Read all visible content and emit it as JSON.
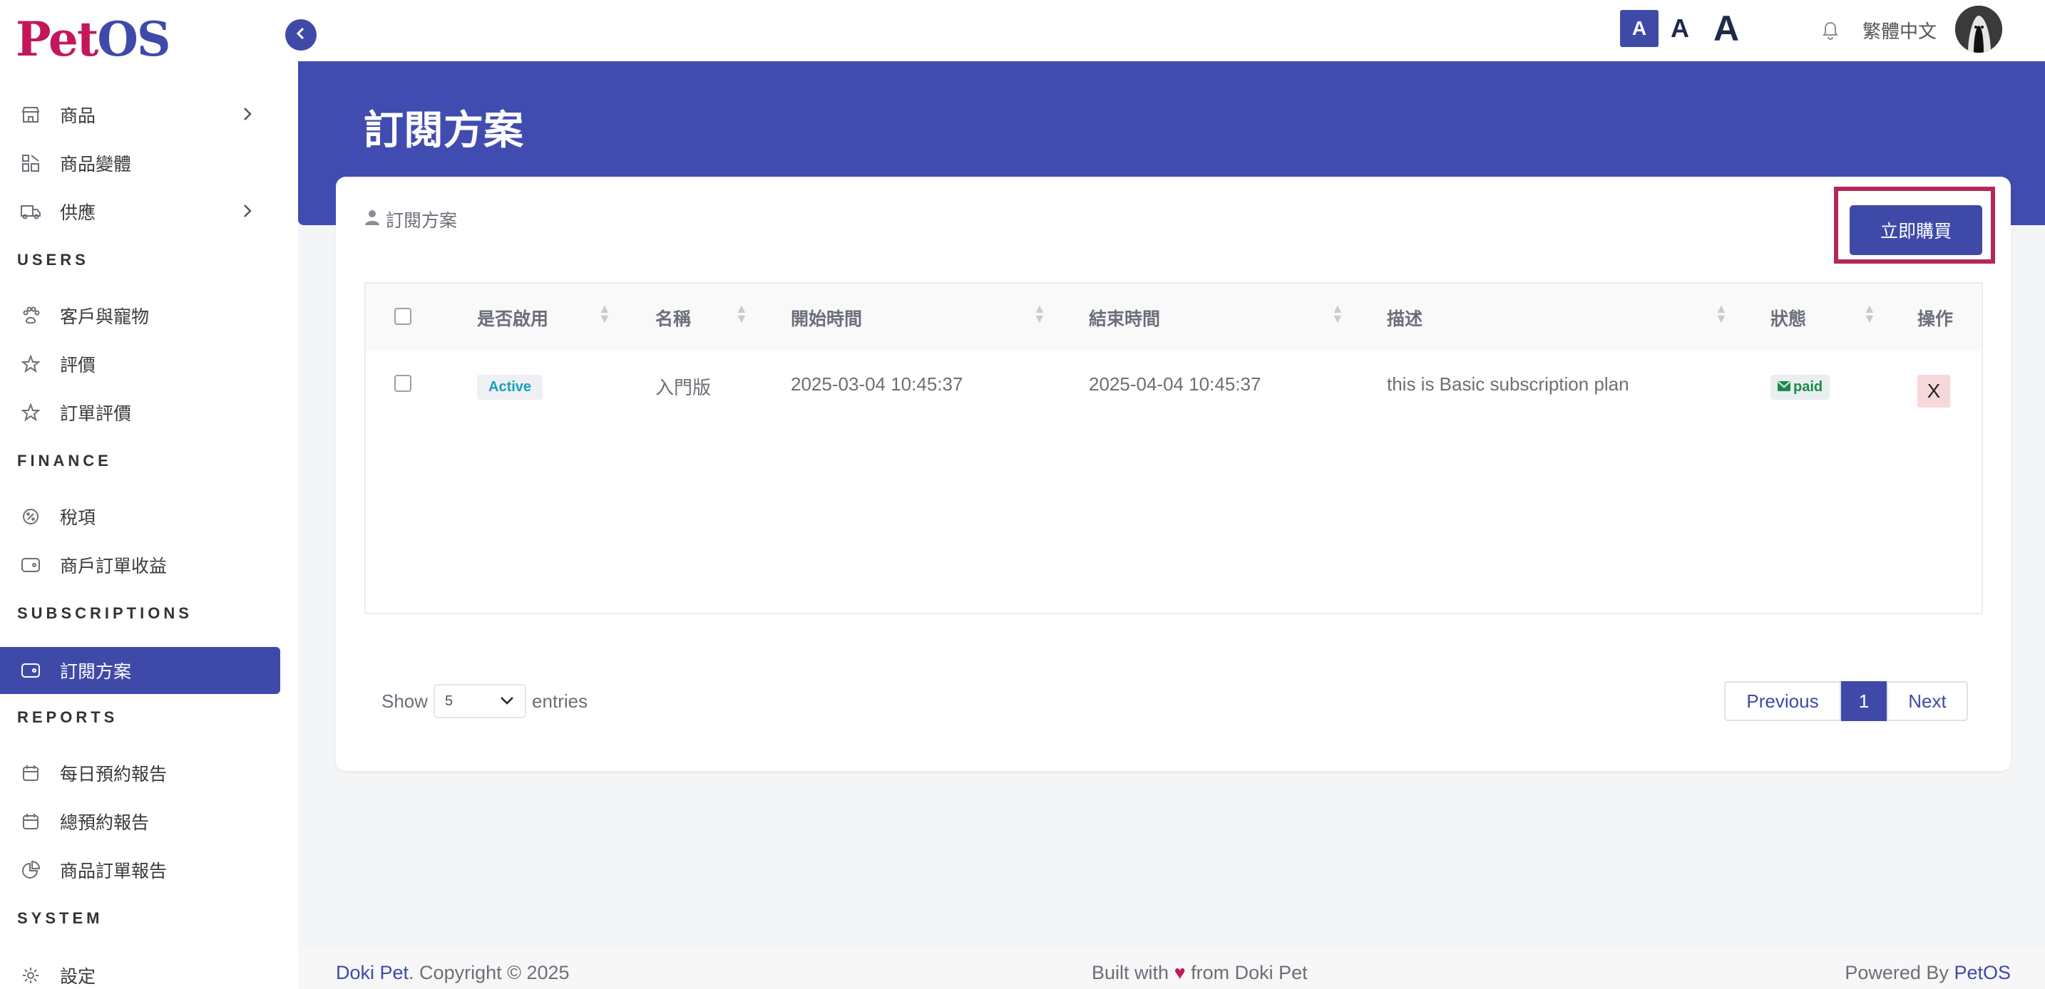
{
  "app": {
    "logo_part1": "Pet",
    "logo_part2": "OS"
  },
  "sidebar": {
    "items": [
      {
        "label": "商品",
        "icon": "store-icon",
        "has_children": true
      },
      {
        "label": "商品變體",
        "icon": "variants-icon",
        "has_children": false
      },
      {
        "label": "供應",
        "icon": "truck-icon",
        "has_children": true
      }
    ],
    "sections": {
      "users": "USERS",
      "finance": "FINANCE",
      "subscriptions": "SUBSCRIPTIONS",
      "reports": "REPORTS",
      "system": "SYSTEM"
    },
    "users_items": [
      {
        "label": "客戶與寵物",
        "icon": "paw-icon"
      },
      {
        "label": "評價",
        "icon": "star-icon"
      },
      {
        "label": "訂單評價",
        "icon": "star-icon"
      }
    ],
    "finance_items": [
      {
        "label": "稅項",
        "icon": "tax-icon"
      },
      {
        "label": "商戶訂單收益",
        "icon": "wallet-icon"
      }
    ],
    "subscriptions_items": [
      {
        "label": "訂閱方案",
        "icon": "wallet-icon",
        "active": true
      }
    ],
    "reports_items": [
      {
        "label": "每日預約報告",
        "icon": "calendar-icon"
      },
      {
        "label": "總預約報告",
        "icon": "calendar-icon"
      },
      {
        "label": "商品訂單報告",
        "icon": "pie-chart-icon"
      }
    ],
    "system_items": [
      {
        "label": "設定",
        "icon": "gear-icon"
      }
    ]
  },
  "topbar": {
    "font_small": "A",
    "font_medium": "A",
    "font_large": "A",
    "language": "繁體中文"
  },
  "page": {
    "title": "訂閱方案",
    "breadcrumb": "訂閱方案",
    "buy_button": "立即購買"
  },
  "table": {
    "headers": [
      "是否啟用",
      "名稱",
      "開始時間",
      "結束時間",
      "描述",
      "狀態",
      "操作"
    ],
    "rows": [
      {
        "enabled": "Active",
        "name": "入門版",
        "start": "2025-03-04 10:45:37",
        "end": "2025-04-04 10:45:37",
        "description": "this is Basic subscription plan",
        "status": "paid",
        "action": "X"
      }
    ]
  },
  "pagination": {
    "show_label": "Show",
    "page_size": "5",
    "entries_label": "entries",
    "previous": "Previous",
    "current": "1",
    "next": "Next"
  },
  "footer": {
    "brand": "Doki Pet",
    "copyright": ". Copyright © 2025",
    "built_pre": "Built with",
    "built_post": "from Doki Pet",
    "powered_pre": "Powered By",
    "powered_brand": "PetOS"
  },
  "colors": {
    "primary": "#3f4aa8",
    "logo_red": "#c2185b",
    "highlight_frame": "#b5275b"
  }
}
